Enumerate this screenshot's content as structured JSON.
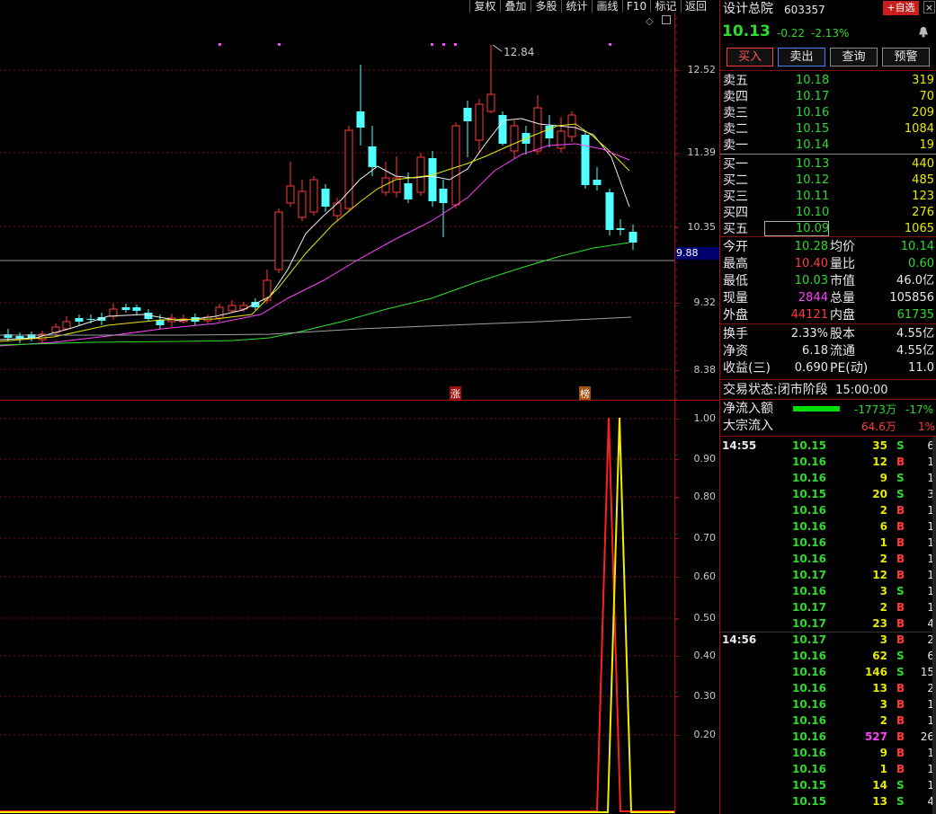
{
  "toolbar": {
    "items": [
      "复权",
      "叠加",
      "多股",
      "统计",
      "画线",
      "F10",
      "标记",
      "返回"
    ]
  },
  "main_axis": {
    "ticks": [
      "12.52",
      "11.39",
      "10.35",
      "9.32",
      "8.38"
    ],
    "current_price_label": "9.88",
    "high_label": "12.84"
  },
  "main_markers": {
    "zhang": "涨",
    "bang": "榜"
  },
  "ind_axis": {
    "ticks": [
      "1.00",
      "0.90",
      "0.80",
      "0.70",
      "0.60",
      "0.50",
      "0.40",
      "0.30",
      "0.20"
    ]
  },
  "stock": {
    "name": "设计总院",
    "code": "603357",
    "add_label": "+自选",
    "price": "10.13",
    "change": "-0.22",
    "pct": "-2.13%"
  },
  "buttons": {
    "buy": "买入",
    "sell": "卖出",
    "query": "查询",
    "alert": "预警"
  },
  "asks": [
    {
      "label": "卖五",
      "price": "10.18",
      "vol": "319"
    },
    {
      "label": "卖四",
      "price": "10.17",
      "vol": "70"
    },
    {
      "label": "卖三",
      "price": "10.16",
      "vol": "209"
    },
    {
      "label": "卖二",
      "price": "10.15",
      "vol": "1084"
    },
    {
      "label": "卖一",
      "price": "10.14",
      "vol": "19"
    }
  ],
  "bids": [
    {
      "label": "买一",
      "price": "10.13",
      "vol": "440"
    },
    {
      "label": "买二",
      "price": "10.12",
      "vol": "485"
    },
    {
      "label": "买三",
      "price": "10.11",
      "vol": "123"
    },
    {
      "label": "买四",
      "price": "10.10",
      "vol": "276"
    },
    {
      "label": "买五",
      "price": "10.09",
      "vol": "1065"
    }
  ],
  "stats": [
    {
      "l1": "今开",
      "v1": "10.28",
      "c1": "gr",
      "l2": "均价",
      "v2": "10.14",
      "c2": "gr"
    },
    {
      "l1": "最高",
      "v1": "10.40",
      "c1": "rd",
      "l2": "量比",
      "v2": "0.60",
      "c2": "gr"
    },
    {
      "l1": "最低",
      "v1": "10.03",
      "c1": "gr",
      "l2": "市值",
      "v2": "46.0亿",
      "c2": "wh"
    },
    {
      "l1": "现量",
      "v1": "2844",
      "c1": "mg",
      "l2": "总量",
      "v2": "105856",
      "c2": "wh"
    },
    {
      "l1": "外盘",
      "v1": "44121",
      "c1": "rd",
      "l2": "内盘",
      "v2": "61735",
      "c2": "gr"
    }
  ],
  "stats2": [
    {
      "l1": "换手",
      "v1": "2.33%",
      "l2": "股本",
      "v2": "4.55亿"
    },
    {
      "l1": "净资",
      "v1": "6.18",
      "l2": "流通",
      "v2": "4.55亿"
    },
    {
      "l1": "收益(三)",
      "v1": "0.690",
      "l2": "PE(动)",
      "v2": "11.0"
    }
  ],
  "status": {
    "label": "交易状态:",
    "value": "闭市阶段",
    "time": "15:00:00"
  },
  "flow": {
    "net_label": "净流入额",
    "net_value": "-1773万",
    "net_pct": "-17%",
    "block_label": "大宗流入",
    "block_value": "64.6万",
    "block_pct": "1%"
  },
  "ticks": [
    {
      "t": "14:55",
      "p": "10.15",
      "v": "35",
      "s": "S",
      "n": "6"
    },
    {
      "t": "",
      "p": "10.16",
      "v": "12",
      "s": "B",
      "n": "1"
    },
    {
      "t": "",
      "p": "10.16",
      "v": "9",
      "s": "S",
      "n": "1"
    },
    {
      "t": "",
      "p": "10.15",
      "v": "20",
      "s": "S",
      "n": "3"
    },
    {
      "t": "",
      "p": "10.16",
      "v": "2",
      "s": "B",
      "n": "1"
    },
    {
      "t": "",
      "p": "10.16",
      "v": "6",
      "s": "B",
      "n": "1"
    },
    {
      "t": "",
      "p": "10.16",
      "v": "1",
      "s": "B",
      "n": "1"
    },
    {
      "t": "",
      "p": "10.16",
      "v": "2",
      "s": "B",
      "n": "1"
    },
    {
      "t": "",
      "p": "10.17",
      "v": "12",
      "s": "B",
      "n": "1"
    },
    {
      "t": "",
      "p": "10.16",
      "v": "3",
      "s": "S",
      "n": "1"
    },
    {
      "t": "",
      "p": "10.17",
      "v": "2",
      "s": "B",
      "n": "1"
    },
    {
      "t": "",
      "p": "10.17",
      "v": "23",
      "s": "B",
      "n": "4"
    },
    {
      "t": "14:56",
      "p": "10.17",
      "v": "3",
      "s": "B",
      "n": "2"
    },
    {
      "t": "",
      "p": "10.16",
      "v": "62",
      "s": "S",
      "n": "6"
    },
    {
      "t": "",
      "p": "10.16",
      "v": "146",
      "s": "S",
      "n": "15"
    },
    {
      "t": "",
      "p": "10.16",
      "v": "13",
      "s": "B",
      "n": "2"
    },
    {
      "t": "",
      "p": "10.16",
      "v": "3",
      "s": "B",
      "n": "1"
    },
    {
      "t": "",
      "p": "10.16",
      "v": "2",
      "s": "B",
      "n": "1"
    },
    {
      "t": "",
      "p": "10.16",
      "v": "527",
      "s": "B",
      "n": "26"
    },
    {
      "t": "",
      "p": "10.16",
      "v": "9",
      "s": "B",
      "n": "1"
    },
    {
      "t": "",
      "p": "10.16",
      "v": "1",
      "s": "B",
      "n": "1"
    },
    {
      "t": "",
      "p": "10.15",
      "v": "14",
      "s": "S",
      "n": "1"
    },
    {
      "t": "",
      "p": "10.15",
      "v": "13",
      "s": "S",
      "n": "4"
    }
  ]
}
